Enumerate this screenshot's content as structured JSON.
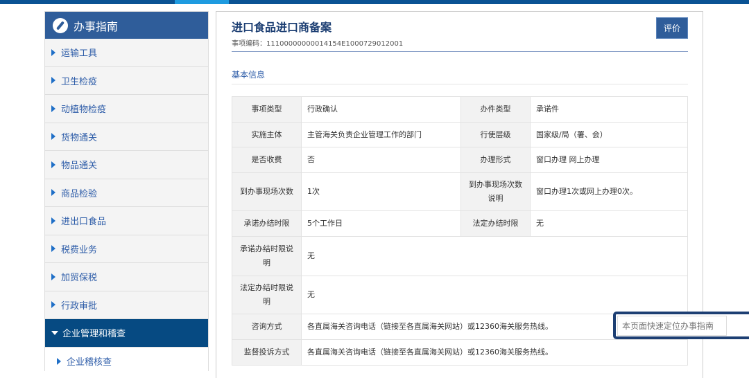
{
  "sidebar": {
    "title": "办事指南",
    "items": [
      "运输工具",
      "卫生检疫",
      "动植物检疫",
      "货物通关",
      "物品通关",
      "商品检验",
      "进出口食品",
      "税费业务",
      "加贸保税",
      "行政审批"
    ],
    "active": "企业管理和稽查",
    "sub": "企业稽核查"
  },
  "main": {
    "title": "进口食品进口商备案",
    "code": "事项编码：11100000000014154E1000729012001",
    "rate_button": "评价",
    "section": "基本信息",
    "rows": [
      [
        "事项类型",
        "行政确认",
        "办件类型",
        "承诺件"
      ],
      [
        "实施主体",
        "主管海关负责企业管理工作的部门",
        "行使层级",
        "国家级/局（署、会）"
      ],
      [
        "是否收费",
        "否",
        "办理形式",
        "窗口办理 网上办理"
      ],
      [
        "到办事现场次数",
        "1次",
        "到办事现场次数说明",
        "窗口办理1次或网上办理0次。"
      ],
      [
        "承诺办结时限",
        "5个工作日",
        "法定办结时限",
        "无"
      ]
    ],
    "wide_rows": [
      [
        "承诺办结时限说明",
        "无"
      ],
      [
        "法定办结时限说明",
        "无"
      ],
      [
        "咨询方式",
        "各直属海关咨询电话（链接至各直属海关网站）或12360海关服务热线。"
      ],
      [
        "监督投诉方式",
        "各直属海关咨询电话（链接至各直属海关网站）或12360海关服务热线。"
      ]
    ]
  },
  "search": {
    "placeholder": "本页面快速定位办事指南"
  }
}
